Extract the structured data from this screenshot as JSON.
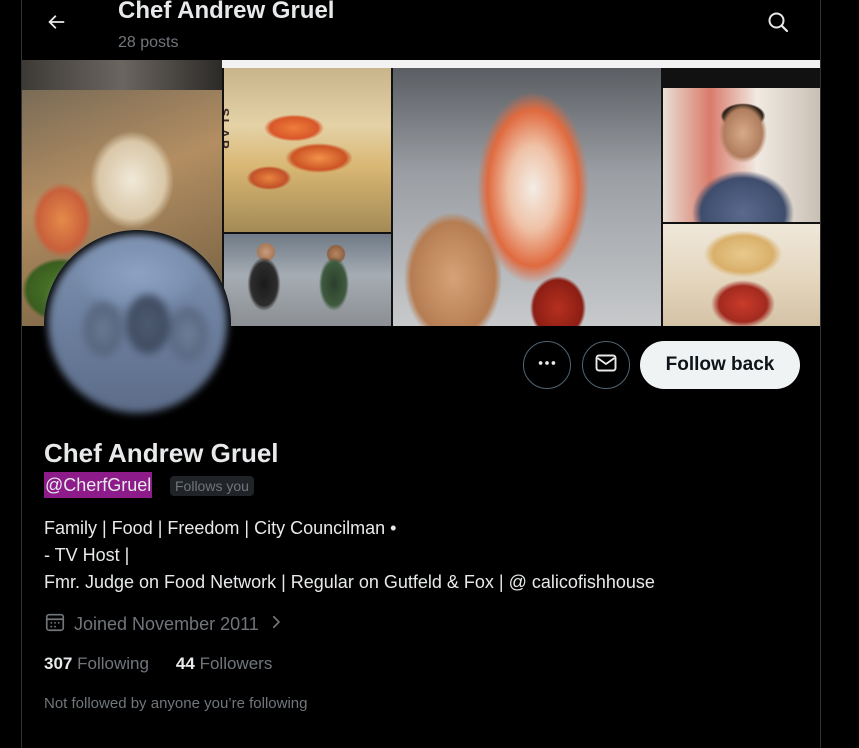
{
  "header": {
    "title": "Chef Andrew Gruel",
    "posts_count": "28 posts"
  },
  "profile": {
    "display_name": "Chef Andrew Gruel",
    "handle": "@CherfGruel",
    "follows_you_badge": "Follows you",
    "bio_lines": [
      "Family | Food | Freedom | City Councilman •",
      "- TV Host |",
      "Fmr. Judge on Food Network | Regular on Gutfeld & Fox | @ calicofishhouse"
    ],
    "joined": "Joined November 2011",
    "following_count": "307",
    "following_label": "Following",
    "followers_count": "44",
    "followers_label": "Followers",
    "mutuals_note": "Not followed by anyone you’re following"
  },
  "actions": {
    "follow_back_label": "Follow back"
  },
  "banner": {
    "sign_text": "SLAP"
  },
  "icons": {
    "back": "arrow-left-icon",
    "search": "search-icon",
    "more": "more-horizontal-icon",
    "message": "mail-icon",
    "calendar": "calendar-icon",
    "chevron": "chevron-right-icon"
  },
  "colors": {
    "background": "#000000",
    "text_primary": "#e7e9ea",
    "text_secondary": "#71767b",
    "border": "#2f3336",
    "follow_button_bg": "#eff3f4",
    "handle_highlight": "#8d1c8a"
  }
}
